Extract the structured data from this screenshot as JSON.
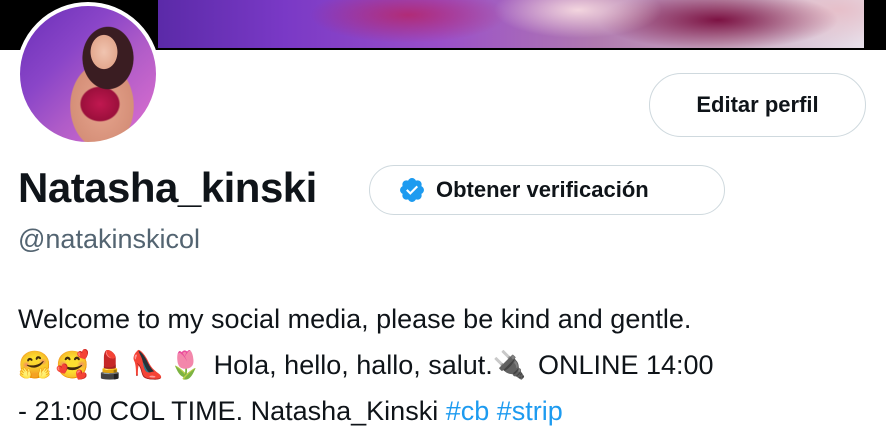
{
  "profile": {
    "display_name": "Natasha_kinski",
    "handle": "@natakinskicol",
    "edit_button_label": "Editar perfil",
    "verify_button_label": "Obtener verificación"
  },
  "bio": {
    "line1": "Welcome to my social media, please be kind and gentle.",
    "line2_emojis": [
      "🤗",
      "🥰",
      "💄",
      "👠",
      "🌷"
    ],
    "line2_text": "Hola, hello, hallo, salut.",
    "line2_plug": "🔌",
    "line2_tail": "ONLINE 14:00",
    "line3_text": "- 21:00 COL TIME. Natasha_Kinski",
    "hashtags": [
      "#cb",
      "#strip"
    ]
  },
  "colors": {
    "accent": "#1d9bf0",
    "text_primary": "#0f1419",
    "text_secondary": "#536471",
    "border": "#cfd9de"
  }
}
